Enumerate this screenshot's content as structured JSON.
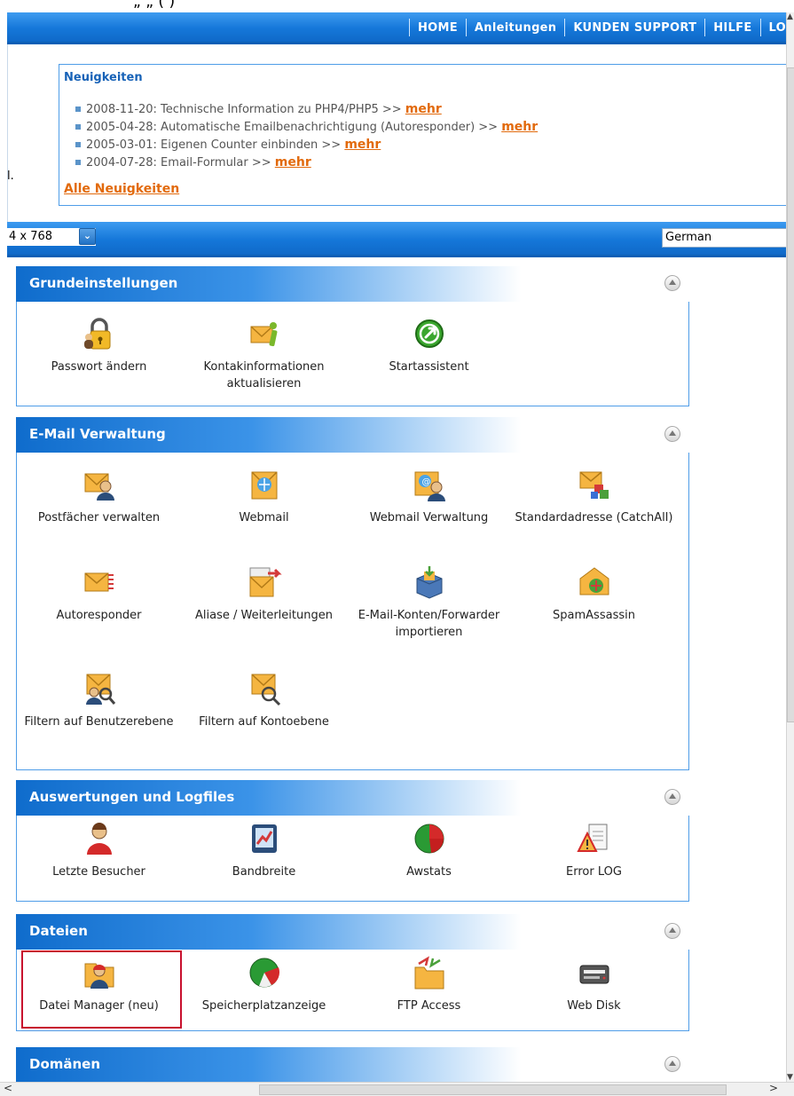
{
  "title_fragment": "„ „ (   )",
  "nav": {
    "items": [
      "HOME",
      "Anleitungen",
      "KUNDEN SUPPORT",
      "HILFE",
      "LO"
    ]
  },
  "news": {
    "title": "Neuigkeiten",
    "items": [
      {
        "text": "2008-11-20: Technische Information zu PHP4/PHP5 >> ",
        "link": "mehr"
      },
      {
        "text": "2005-04-28: Automatische Emailbenachrichtigung (Autoresponder) >> ",
        "link": "mehr"
      },
      {
        "text": "2005-03-01: Eigenen Counter einbinden >> ",
        "link": "mehr"
      },
      {
        "text": "2004-07-28: Email-Formular >> ",
        "link": "mehr"
      }
    ],
    "all_link": "Alle Neuigkeiten",
    "stray": "l."
  },
  "bar2": {
    "resolution": "4 x 768",
    "dropdown_arrow": "⌄",
    "language": "German"
  },
  "sections": {
    "grund": {
      "title": "Grundeinstellungen",
      "tiles": [
        {
          "label": "Passwort ändern",
          "icon": "lock-user-icon"
        },
        {
          "label": "Kontakinformationen aktualisieren",
          "icon": "envelope-info-icon"
        },
        {
          "label": "Startassistent",
          "icon": "start-wizard-icon"
        }
      ]
    },
    "email": {
      "title": "E-Mail Verwaltung",
      "tiles": [
        {
          "label": "Postfächer verwalten",
          "icon": "mailbox-user-icon"
        },
        {
          "label": "Webmail",
          "icon": "webmail-icon"
        },
        {
          "label": "Webmail Verwaltung",
          "icon": "webmail-admin-icon"
        },
        {
          "label": "Standardadresse (CatchAll)",
          "icon": "catchall-icon"
        },
        {
          "label": "Autoresponder",
          "icon": "autoresponder-icon"
        },
        {
          "label": "Aliase / Weiterleitungen",
          "icon": "forwarders-icon"
        },
        {
          "label": "E-Mail-Konten/Forwarder importieren",
          "icon": "import-icon"
        },
        {
          "label": "SpamAssassin",
          "icon": "spamassassin-icon"
        },
        {
          "label": "Filtern auf Benutzerebene",
          "icon": "user-filter-icon"
        },
        {
          "label": "Filtern auf Kontoebene",
          "icon": "account-filter-icon"
        }
      ]
    },
    "stats": {
      "title": "Auswertungen und Logfiles",
      "tiles": [
        {
          "label": "Letzte Besucher",
          "icon": "visitors-icon"
        },
        {
          "label": "Bandbreite",
          "icon": "bandwidth-icon"
        },
        {
          "label": "Awstats",
          "icon": "awstats-icon"
        },
        {
          "label": "Error LOG",
          "icon": "error-log-icon"
        }
      ]
    },
    "files": {
      "title": "Dateien",
      "tiles": [
        {
          "label": "Datei Manager (neu)",
          "icon": "file-manager-icon"
        },
        {
          "label": "Speicherplatzanzeige",
          "icon": "disk-usage-icon"
        },
        {
          "label": "FTP Access",
          "icon": "ftp-icon"
        },
        {
          "label": "Web Disk",
          "icon": "web-disk-icon"
        }
      ]
    },
    "domains": {
      "title": "Domänen"
    }
  },
  "colors": {
    "brand_blue": "#1577d9",
    "link_orange": "#e26a0c",
    "selection_red": "#c8102e"
  }
}
